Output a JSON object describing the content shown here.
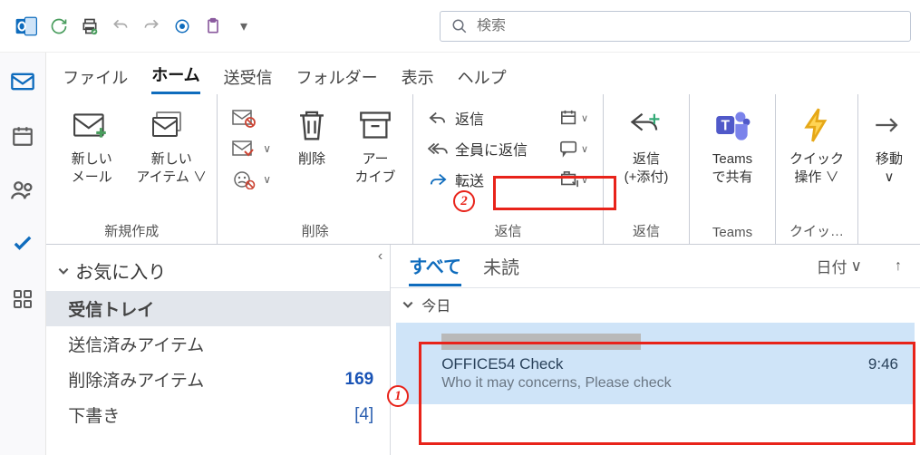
{
  "search": {
    "placeholder": "検索"
  },
  "tabs": {
    "file": "ファイル",
    "home": "ホーム",
    "sendrecv": "送受信",
    "folder": "フォルダー",
    "view": "表示",
    "help": "ヘルプ"
  },
  "ribbon": {
    "newmail": "新しい\nメール",
    "newitem": "新しい\nアイテム",
    "g_create": "新規作成",
    "delete": "削除",
    "archive": "アー\nカイブ",
    "g_delete": "削除",
    "reply": "返信",
    "replyall": "全員に返信",
    "forward": "転送",
    "g_respond": "返信",
    "replyattach": "返信\n(+添付)",
    "g_replyattach": "返信",
    "teams": "Teams\nで共有",
    "g_teams": "Teams",
    "quick": "クイック\n操作",
    "g_quick": "クイッ…",
    "move": "移動"
  },
  "folders": {
    "favorites": "お気に入り",
    "inbox": "受信トレイ",
    "sent": "送信済みアイテム",
    "deleted": "削除済みアイテム",
    "deleted_count": "169",
    "drafts": "下書き",
    "drafts_count": "[4]"
  },
  "filter": {
    "all": "すべて",
    "unread": "未読",
    "sort": "日付"
  },
  "group": {
    "today": "今日"
  },
  "message": {
    "subject": "OFFICE54 Check",
    "time": "9:46",
    "preview": "Who it may concerns,  Please check"
  },
  "markers": {
    "m1": "1",
    "m2": "2"
  }
}
